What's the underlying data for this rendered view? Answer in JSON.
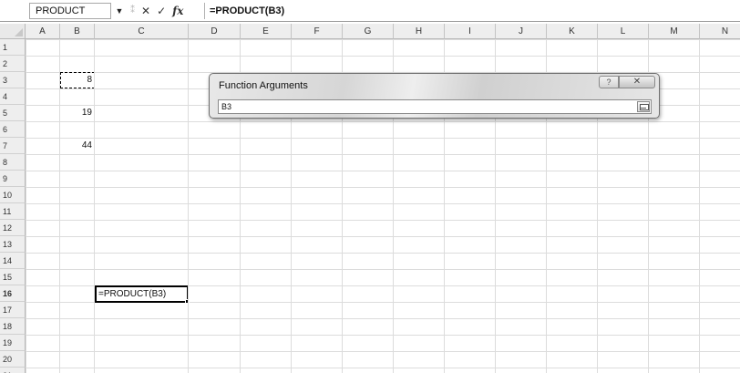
{
  "formula_bar": {
    "name_box": "PRODUCT",
    "dropdown_icon": "chevron-down-icon",
    "icons": [
      "fx-icon",
      "cancel-icon",
      "enter-icon"
    ],
    "cancel_glyph": "✕",
    "enter_glyph": "✓",
    "fx_glyph": "fx",
    "formula": "=PRODUCT(B3)"
  },
  "columns": [
    "A",
    "B",
    "C",
    "D",
    "E",
    "F",
    "G",
    "H",
    "I",
    "J",
    "K",
    "L",
    "M",
    "N"
  ],
  "rows": [
    "1",
    "2",
    "3",
    "4",
    "5",
    "6",
    "7",
    "8",
    "9",
    "10",
    "11",
    "12",
    "13",
    "14",
    "15",
    "16",
    "17",
    "18",
    "19",
    "20",
    "21"
  ],
  "cells": {
    "b3": "8",
    "b5": "19",
    "b7": "44",
    "c16": "=PRODUCT(B3)"
  },
  "dialog": {
    "title": "Function Arguments",
    "help_label": "?",
    "close_label": "✕",
    "argument_value": "B3"
  }
}
